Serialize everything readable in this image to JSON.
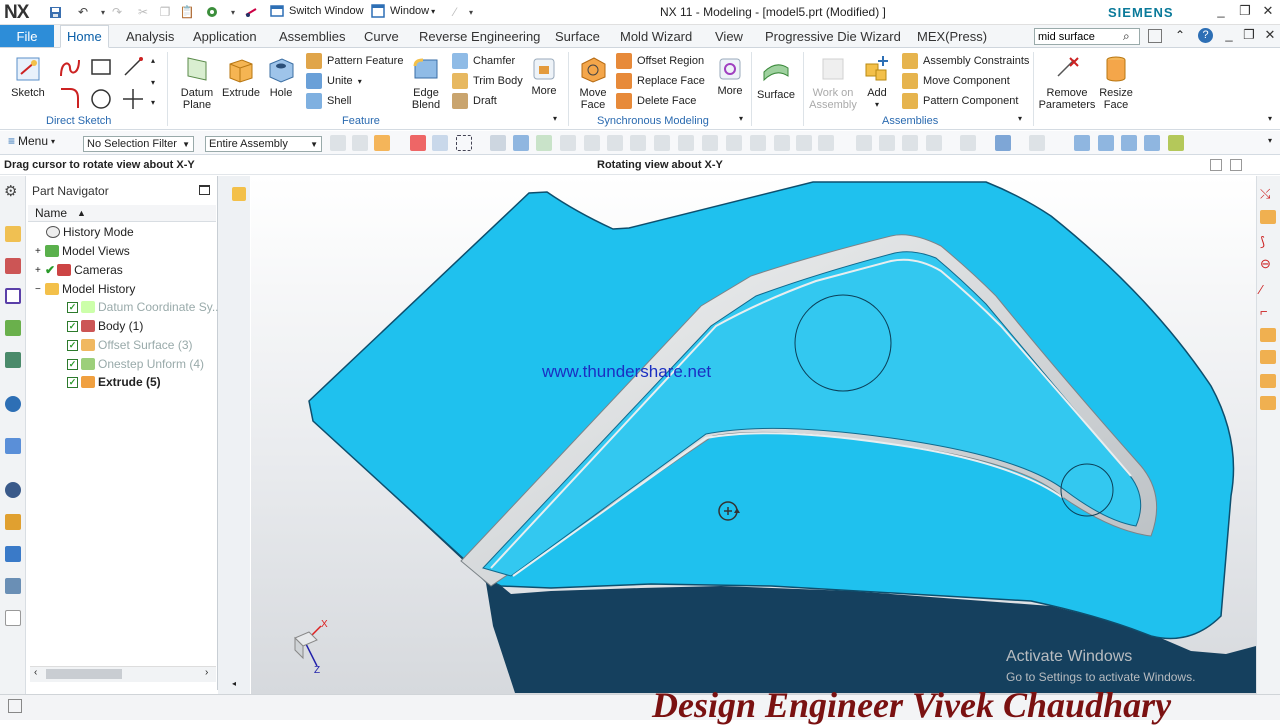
{
  "app": {
    "logo": "NX",
    "title": "NX 11 - Modeling - [model5.prt (Modified) ]",
    "brand": "SIEMENS",
    "switch_window": "Switch Window",
    "window_menu": "Window"
  },
  "tabs": [
    "File",
    "Home",
    "Analysis",
    "Application",
    "Assemblies",
    "Curve",
    "Reverse Engineering",
    "Surface",
    "Mold Wizard",
    "View",
    "Progressive Die Wizard",
    "MEX(Press)"
  ],
  "search": {
    "value": "mid surface"
  },
  "ribbon": {
    "sketch": "Sketch",
    "datum_plane": "Datum Plane",
    "extrude": "Extrude",
    "hole": "Hole",
    "pattern_feature": "Pattern Feature",
    "unite": "Unite",
    "shell": "Shell",
    "edge_blend": "Edge Blend",
    "chamfer": "Chamfer",
    "trim_body": "Trim Body",
    "draft": "Draft",
    "more1": "More",
    "move_face": "Move Face",
    "offset_region": "Offset Region",
    "replace_face": "Replace Face",
    "delete_face": "Delete Face",
    "more2": "More",
    "surface": "Surface",
    "work_on_assembly": "Work on Assembly",
    "add": "Add",
    "assembly_constraints": "Assembly Constraints",
    "move_component": "Move Component",
    "pattern_component": "Pattern Component",
    "remove_parameters": "Remove Parameters",
    "resize_face": "Resize Face",
    "groups": {
      "direct_sketch": "Direct Sketch",
      "feature": "Feature",
      "synchronous_modeling": "Synchronous Modeling",
      "assemblies": "Assemblies"
    }
  },
  "toolbar2": {
    "menu": "Menu",
    "selection_filter": "No Selection Filter",
    "scope": "Entire Assembly"
  },
  "cue": {
    "left": "Drag cursor to rotate view about X-Y",
    "center": "Rotating view about X-Y"
  },
  "navigator": {
    "title": "Part Navigator",
    "column": "Name",
    "items": [
      {
        "label": "History Mode"
      },
      {
        "label": "Model Views"
      },
      {
        "label": "Cameras"
      },
      {
        "label": "Model History"
      },
      {
        "label": "Datum Coordinate Sy..."
      },
      {
        "label": "Body (1)"
      },
      {
        "label": "Offset Surface (3)"
      },
      {
        "label": "Onestep Unform (4)"
      },
      {
        "label": "Extrude (5)"
      }
    ]
  },
  "viewport": {
    "watermark_url": "www.thundershare.net",
    "axis_x": "X",
    "axis_z": "Z",
    "activate_title": "Activate Windows",
    "activate_sub": "Go to Settings to activate Windows."
  },
  "branding": "Design Engineer Vivek Chaudhary",
  "colors": {
    "accent": "#2d8dd8",
    "part": "#1fc0ee",
    "brand_text": "#7a1111"
  }
}
